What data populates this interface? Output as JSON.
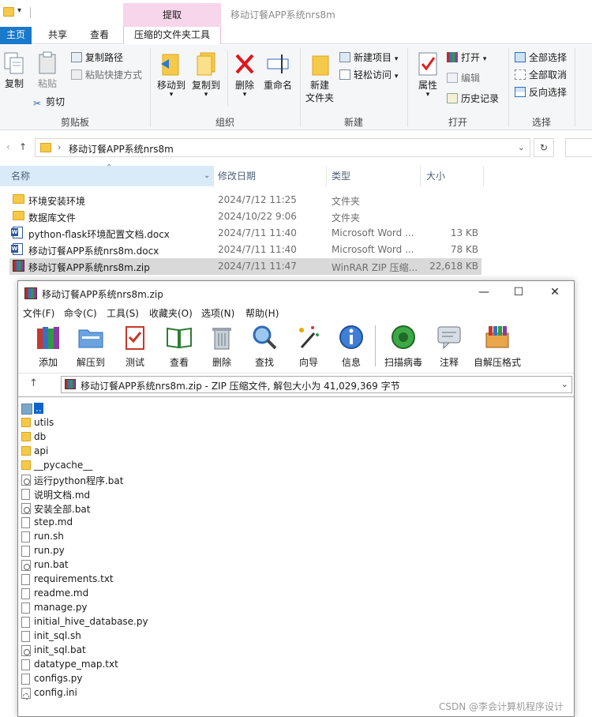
{
  "explorer": {
    "window_title": "移动订餐APP系统nrs8m",
    "context_group": "提取",
    "tabs": {
      "home": "主页",
      "share": "共享",
      "view": "查看",
      "tools": "压缩的文件夹工具"
    },
    "ribbon": {
      "clipboard": {
        "group": "剪贴板",
        "copy": "复制",
        "paste": "粘贴",
        "copy_path": "复制路径",
        "paste_shortcut": "粘贴快捷方式",
        "cut": "剪切"
      },
      "organize": {
        "group": "组织",
        "move_to": "移动到",
        "copy_to": "复制到",
        "delete": "删除",
        "rename": "重命名"
      },
      "new": {
        "group": "新建",
        "new_folder_l1": "新建",
        "new_folder_l2": "文件夹",
        "new_item": "新建项目",
        "easy_access": "轻松访问"
      },
      "open": {
        "group": "打开",
        "properties": "属性",
        "open": "打开",
        "edit": "编辑",
        "history": "历史记录"
      },
      "select": {
        "group": "选择",
        "select_all": "全部选择",
        "select_none": "全部取消",
        "invert": "反向选择"
      }
    },
    "address": {
      "path": "移动订餐APP系统nrs8m"
    },
    "columns": {
      "name": "名称",
      "date": "修改日期",
      "type": "类型",
      "size": "大小"
    },
    "files": [
      {
        "name": "环境安装环境",
        "date": "2024/7/12 11:25",
        "type": "文件夹",
        "size": "",
        "icon": "folder-icon"
      },
      {
        "name": "数据库文件",
        "date": "2024/10/22 9:06",
        "type": "文件夹",
        "size": "",
        "icon": "folder-icon"
      },
      {
        "name": "python-flask环境配置文档.docx",
        "date": "2024/7/11 11:40",
        "type": "Microsoft Word ...",
        "size": "13 KB",
        "icon": "word-doc-icon"
      },
      {
        "name": "移动订餐APP系统nrs8m.docx",
        "date": "2024/7/11 11:40",
        "type": "Microsoft Word ...",
        "size": "78 KB",
        "icon": "word-doc-icon"
      },
      {
        "name": "移动订餐APP系统nrs8m.zip",
        "date": "2024/7/11 11:47",
        "type": "WinRAR ZIP 压缩...",
        "size": "22,618 KB",
        "icon": "winrar-archive-icon"
      }
    ]
  },
  "winrar": {
    "title": "移动订餐APP系统nrs8m.zip",
    "menu": [
      "文件(F)",
      "命令(C)",
      "工具(S)",
      "收藏夹(O)",
      "选项(N)",
      "帮助(H)"
    ],
    "toolbar": [
      "添加",
      "解压到",
      "测试",
      "查看",
      "删除",
      "查找",
      "向导",
      "信息",
      "扫描病毒",
      "注释",
      "自解压格式"
    ],
    "path_text": "移动订餐APP系统nrs8m.zip - ZIP 压缩文件, 解包大小为 41,029,369 字节",
    "items": [
      {
        "name": "..",
        "icon": "up-folder-icon"
      },
      {
        "name": "utils",
        "icon": "folder-icon"
      },
      {
        "name": "db",
        "icon": "folder-icon"
      },
      {
        "name": "api",
        "icon": "folder-icon"
      },
      {
        "name": "__pycache__",
        "icon": "folder-icon"
      },
      {
        "name": "运行python程序.bat",
        "icon": "batch-file-icon"
      },
      {
        "name": "说明文档.md",
        "icon": "file-icon"
      },
      {
        "name": "安装全部.bat",
        "icon": "batch-file-icon"
      },
      {
        "name": "step.md",
        "icon": "file-icon"
      },
      {
        "name": "run.sh",
        "icon": "file-icon"
      },
      {
        "name": "run.py",
        "icon": "file-icon"
      },
      {
        "name": "run.bat",
        "icon": "batch-file-icon"
      },
      {
        "name": "requirements.txt",
        "icon": "file-icon"
      },
      {
        "name": "readme.md",
        "icon": "file-icon"
      },
      {
        "name": "manage.py",
        "icon": "file-icon"
      },
      {
        "name": "initial_hive_database.py",
        "icon": "file-icon"
      },
      {
        "name": "init_sql.sh",
        "icon": "file-icon"
      },
      {
        "name": "init_sql.bat",
        "icon": "batch-file-icon"
      },
      {
        "name": "datatype_map.txt",
        "icon": "file-icon"
      },
      {
        "name": "configs.py",
        "icon": "file-icon"
      },
      {
        "name": "config.ini",
        "icon": "config-file-icon"
      }
    ]
  },
  "watermark": "CSDN @李会计算机程序设计",
  "colors": {
    "accent": "#1979ca",
    "context_tab": "#f7d5ea",
    "selection": "#0a64c8"
  }
}
